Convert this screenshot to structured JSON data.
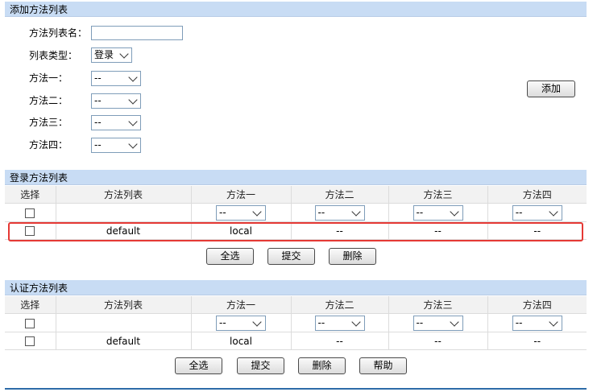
{
  "add_section": {
    "title": "添加方法列表",
    "name_label": "方法列表名：",
    "name_value": "",
    "type_label": "列表类型：",
    "type_value": "登录",
    "method1_label": "方法一：",
    "method2_label": "方法二：",
    "method3_label": "方法三：",
    "method4_label": "方法四：",
    "method1_value": "--",
    "method2_value": "--",
    "method3_value": "--",
    "method4_value": "--",
    "add_button": "添加"
  },
  "login_section": {
    "title": "登录方法列表",
    "columns": [
      "选择",
      "方法列表",
      "方法一",
      "方法二",
      "方法三",
      "方法四"
    ],
    "filters": [
      "--",
      "--",
      "--",
      "--"
    ],
    "rows": [
      {
        "list": "default",
        "m1": "local",
        "m2": "--",
        "m3": "--",
        "m4": "--"
      }
    ],
    "buttons": {
      "select_all": "全选",
      "submit": "提交",
      "delete": "删除"
    }
  },
  "auth_section": {
    "title": "认证方法列表",
    "columns": [
      "选择",
      "方法列表",
      "方法一",
      "方法二",
      "方法三",
      "方法四"
    ],
    "filters": [
      "--",
      "--",
      "--",
      "--"
    ],
    "rows": [
      {
        "list": "default",
        "m1": "local",
        "m2": "--",
        "m3": "--",
        "m4": "--"
      }
    ],
    "buttons": {
      "select_all": "全选",
      "submit": "提交",
      "delete": "删除",
      "help": "帮助"
    }
  },
  "colors": {
    "header_bg": "#c8dcf4",
    "highlight": "#e53935",
    "bottom_line": "#2d6ba8"
  }
}
